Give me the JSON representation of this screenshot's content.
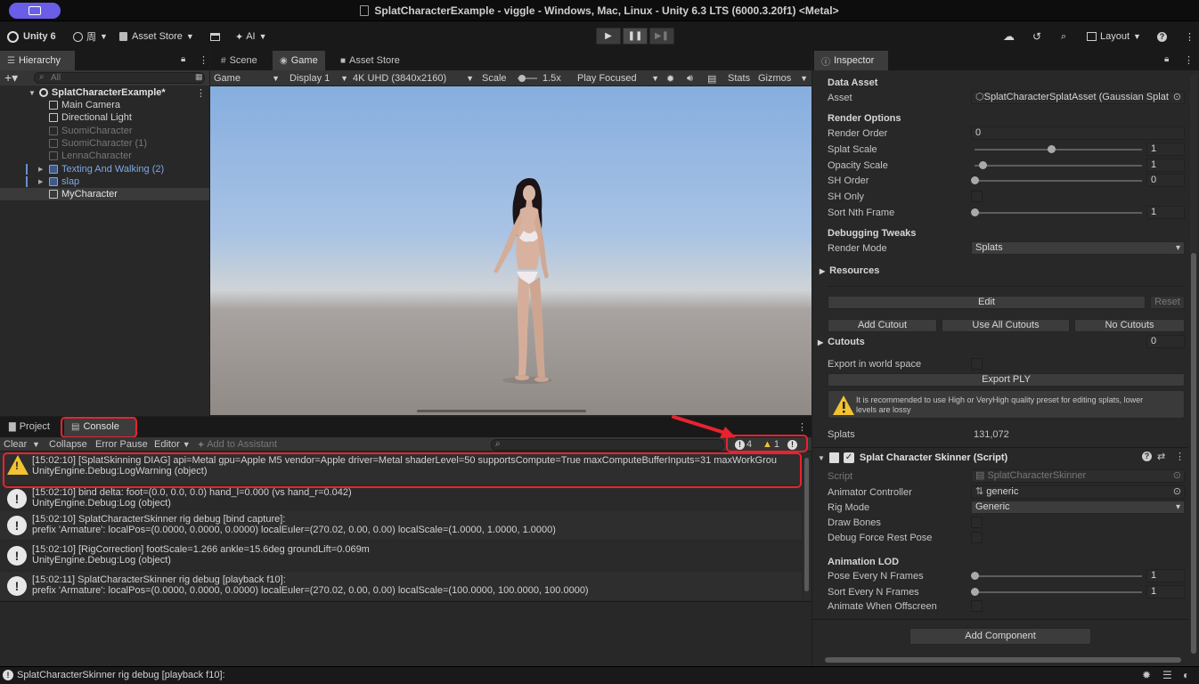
{
  "window": {
    "title": "SplatCharacterExample - viggle - Windows, Mac, Linux - Unity 6.3 LTS (6000.3.20f1) <Metal>"
  },
  "toolbar": {
    "unity_label": "Unity 6",
    "account_label": "周",
    "asset_store_label": "Asset Store",
    "ai_label": "AI",
    "layout_label": "Layout"
  },
  "hierarchy": {
    "tab_label": "Hierarchy",
    "search_placeholder": "All",
    "scene_name": "SplatCharacterExample*",
    "items": [
      {
        "label": "Main Camera",
        "state": "normal"
      },
      {
        "label": "Directional Light",
        "state": "normal"
      },
      {
        "label": "SuomiCharacter",
        "state": "disabled"
      },
      {
        "label": "SuomiCharacter (1)",
        "state": "disabled"
      },
      {
        "label": "LennaCharacter",
        "state": "disabled"
      },
      {
        "label": "Texting And Walking (2)",
        "state": "prefab"
      },
      {
        "label": "slap",
        "state": "prefab"
      },
      {
        "label": "MyCharacter",
        "state": "selected"
      }
    ]
  },
  "center_tabs": {
    "scene": "Scene",
    "game": "Game",
    "asset_store": "Asset Store"
  },
  "game_toolbar": {
    "mode": "Game",
    "display": "Display 1",
    "resolution": "4K UHD (3840x2160)",
    "scale_label": "Scale",
    "scale_value": "1.5x",
    "play_mode": "Play Focused",
    "stats": "Stats",
    "gizmos": "Gizmos"
  },
  "bottom_tabs": {
    "project": "Project",
    "console": "Console"
  },
  "console_toolbar": {
    "clear": "Clear",
    "collapse": "Collapse",
    "error_pause": "Error Pause",
    "editor": "Editor",
    "add_to_assistant": "Add to Assistant",
    "log_count": "4",
    "warning_count": "1"
  },
  "console_logs": [
    {
      "type": "warning",
      "line1": "[15:02:10] [SplatSkinning DIAG] api=Metal gpu=Apple M5 vendor=Apple driver=Metal shaderLevel=50 supportsCompute=True maxComputeBufferInputs=31 maxWorkGrou",
      "line2": "UnityEngine.Debug:LogWarning (object)"
    },
    {
      "type": "info",
      "line1": "[15:02:10] bind delta: foot=(0.0, 0.0, 0.0) hand_l=0.000 (vs hand_r=0.042)",
      "line2": "UnityEngine.Debug:Log (object)"
    },
    {
      "type": "info",
      "line1": "[15:02:10] SplatCharacterSkinner rig debug [bind capture]:",
      "line2": "prefix 'Armature': localPos=(0.0000, 0.0000, 0.0000) localEuler=(270.02, 0.00, 0.00) localScale=(1.0000, 1.0000, 1.0000)"
    },
    {
      "type": "info",
      "line1": "[15:02:10] [RigCorrection] footScale=1.266 ankle=15.6deg groundLift=0.069m",
      "line2": "UnityEngine.Debug:Log (object)"
    },
    {
      "type": "info",
      "line1": "[15:02:11] SplatCharacterSkinner rig debug [playback f10]:",
      "line2": "prefix 'Armature': localPos=(0.0000, 0.0000, 0.0000) localEuler=(270.02, 0.00, 0.00) localScale=(100.0000, 100.0000, 100.0000)"
    }
  ],
  "status_bar": {
    "message": "SplatCharacterSkinner rig debug [playback f10]:"
  },
  "inspector": {
    "tab_label": "Inspector",
    "data_asset_header": "Data Asset",
    "asset_label": "Asset",
    "asset_value": "SplatCharacterSplatAsset (Gaussian Splat",
    "render_options_header": "Render Options",
    "render_order_label": "Render Order",
    "render_order_value": "0",
    "splat_scale_label": "Splat Scale",
    "splat_scale_value": "1",
    "splat_scale_level": 0.46,
    "opacity_scale_label": "Opacity Scale",
    "opacity_scale_value": "1",
    "opacity_scale_level": 0.05,
    "sh_order_label": "SH Order",
    "sh_order_value": "0",
    "sh_order_level": 0.0,
    "sh_only_label": "SH Only",
    "sort_nth_label": "Sort Nth Frame",
    "sort_nth_value": "1",
    "sort_nth_level": 0.0,
    "debugging_header": "Debugging Tweaks",
    "render_mode_label": "Render Mode",
    "render_mode_value": "Splats",
    "resources_label": "Resources",
    "edit_button": "Edit",
    "reset_button": "Reset",
    "add_cutout_button": "Add Cutout",
    "use_all_cutouts_button": "Use All Cutouts",
    "no_cutouts_button": "No Cutouts",
    "cutouts_label": "Cutouts",
    "cutouts_value": "0",
    "export_world_label": "Export in world space",
    "export_ply_button": "Export PLY",
    "warning_text_1": "It is recommended to use High or VeryHigh quality preset for editing splats, lower",
    "warning_text_2": "levels are lossy",
    "splats_label": "Splats",
    "splats_value": "131,072",
    "component_title": "Splat Character Skinner (Script)",
    "script_label": "Script",
    "script_value": "SplatCharacterSkinner",
    "animator_label": "Animator Controller",
    "animator_value": "generic",
    "rig_mode_label": "Rig Mode",
    "rig_mode_value": "Generic",
    "draw_bones_label": "Draw Bones",
    "debug_force_label": "Debug Force Rest Pose",
    "animation_lod_header": "Animation LOD",
    "pose_every_label": "Pose Every N Frames",
    "pose_every_value": "1",
    "pose_every_level": 0.0,
    "sort_every_label": "Sort Every N Frames",
    "sort_every_value": "1",
    "sort_every_level": 0.0,
    "animate_offscreen_label": "Animate When Offscreen",
    "add_component_button": "Add Component"
  },
  "colors": {
    "accent_purple": "#6a5de8",
    "highlight_red": "#e8232f",
    "warning_yellow": "#f2c230",
    "prefab_blue": "#7ea6e6"
  }
}
